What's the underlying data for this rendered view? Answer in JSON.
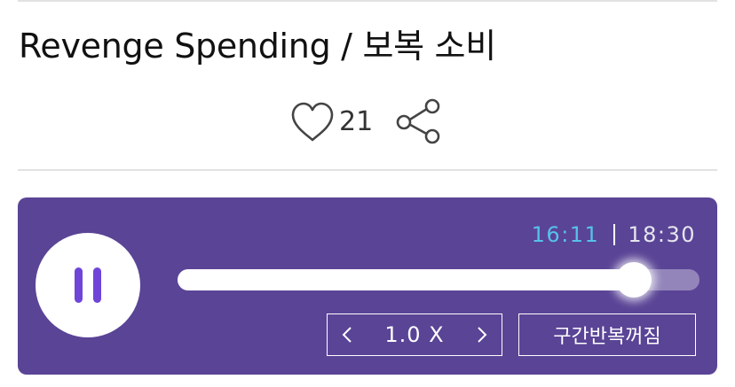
{
  "article": {
    "title": "Revenge Spending / 보복 소비",
    "like_count": "21"
  },
  "icons": {
    "like": "heart-outline-icon",
    "share": "share-icon",
    "play_state": "pause-icon",
    "speed_down": "chevron-left-icon",
    "speed_up": "chevron-right-icon"
  },
  "player": {
    "current_time": "16:11",
    "total_time": "18:30",
    "progress_fraction": 0.8748,
    "speed_label": "1.0 X",
    "repeat_label": "구간반복꺼짐"
  },
  "colors": {
    "player_background": "#5a4496",
    "current_time": "#56c2ea",
    "pause_icon": "#6f45d8"
  }
}
